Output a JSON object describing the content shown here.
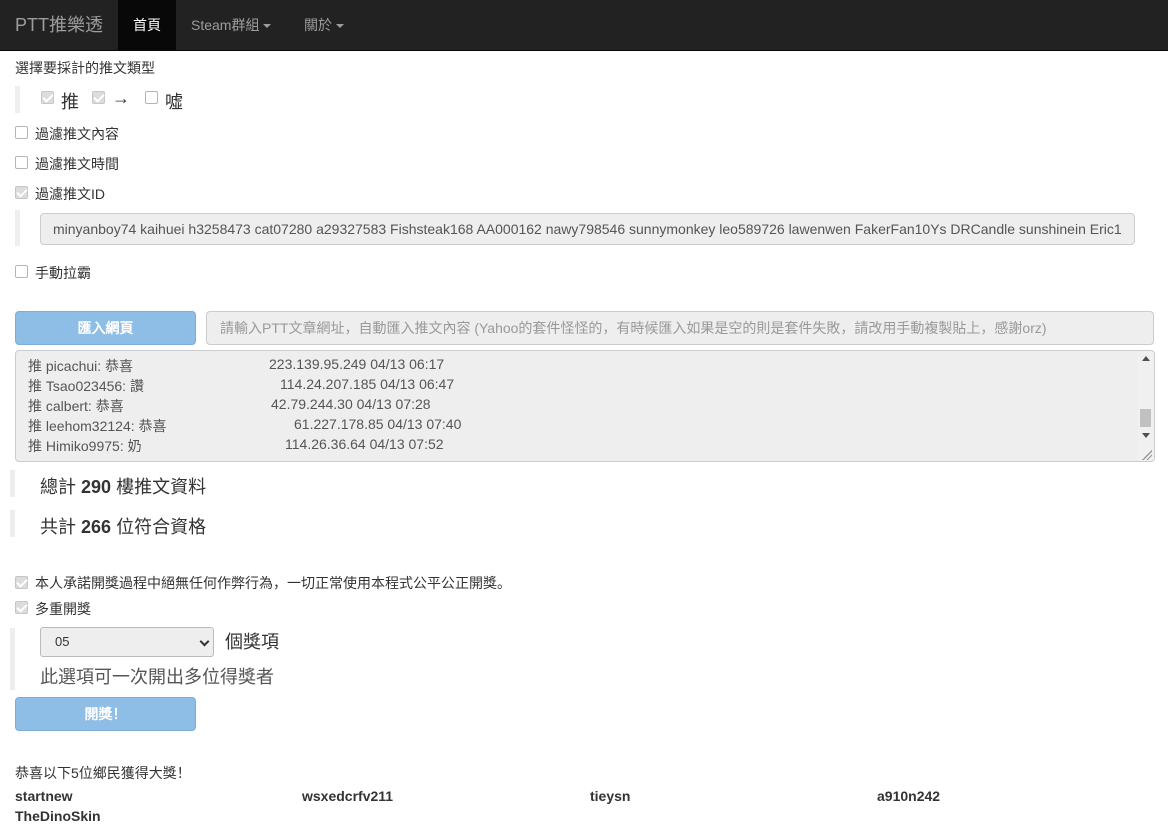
{
  "nav": {
    "brand": "PTT推樂透",
    "home": "首頁",
    "steam": "Steam群組",
    "about": "關於"
  },
  "filter": {
    "heading": "選擇要採計的推文類型",
    "types": [
      {
        "label": "推",
        "checked": true
      },
      {
        "label": "→",
        "checked": true
      },
      {
        "label": "噓",
        "checked": false
      }
    ],
    "content_label": "過濾推文內容",
    "time_label": "過濾推文時間",
    "id_label": "過濾推文ID",
    "id_value": "minyanboy74 kaihuei h3258473 cat07280 a29327583 Fishsteak168 AA000162 nawy798546 sunnymonkey leo589726 lawenwen FakerFan10Ys DRCandle sunshinein Eric1",
    "manual_label": "手動拉霸"
  },
  "import": {
    "button": "匯入網頁",
    "placeholder": "請輸入PTT文章網址，自動匯入推文內容 (Yahoo的套件怪怪的，有時候匯入如果是空的則是套件失敗，請改用手動複製貼上，感謝orz)"
  },
  "pushes": [
    {
      "text": "推 picachui: 恭喜",
      "meta": "223.139.95.249 04/13 06:17"
    },
    {
      "text": "推 Tsao023456: 讚",
      "meta": "114.24.207.185 04/13 06:47"
    },
    {
      "text": "推 calbert: 恭喜",
      "meta": "42.79.244.30 04/13 07:28"
    },
    {
      "text": "推 leehom32124: 恭喜",
      "meta": "61.227.178.85 04/13 07:40"
    },
    {
      "text": "推 Himiko9975: 奶",
      "meta": "114.26.36.64 04/13 07:52"
    }
  ],
  "stats": {
    "total_prefix": "總計",
    "total_count": "290",
    "total_suffix": "樓推文資料",
    "qualified_prefix": "共計",
    "qualified_count": "266",
    "qualified_suffix": "位符合資格"
  },
  "draw": {
    "promise_label": "本人承諾開獎過程中絕無任何作弊行為，一切正常使用本程式公平公正開獎。",
    "multi_label": "多重開獎",
    "count_value": "05",
    "count_suffix": "個獎項",
    "multi_hint": "此選項可一次開出多位得獎者",
    "button": "開獎！"
  },
  "result": {
    "heading": "恭喜以下5位鄉民獲得大獎！",
    "winners": [
      "startnew",
      "wsxedcrfv211",
      "tieysn",
      "a910n242",
      "TheDinoSkin"
    ]
  },
  "colors": {
    "navbar": "#222222",
    "button": "#8ebde6",
    "field_bg": "#eeeeee"
  }
}
